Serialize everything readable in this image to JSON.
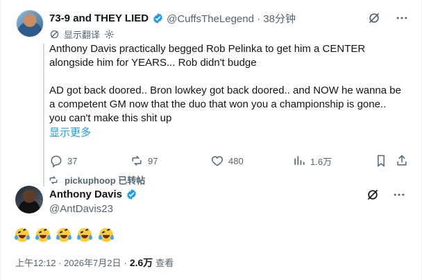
{
  "quoted_post": {
    "author_name": "73-9 and THEY LIED",
    "handle_time": "@CuffsTheLegend · 38分钟",
    "translate_text": "显示翻译",
    "body": "Anthony Davis practically begged Rob Pelinka to get him a CENTER\nalongside him for YEARS... Rob didn't budge\n\nAD got back doored.. Bron lowkey got back doored.. and NOW he wanna be\na competent GM now that the duo that won you a championship is gone..\nyou can't make this shit up",
    "show_more": "显示更多",
    "stats": {
      "replies": "37",
      "reposts": "97",
      "likes": "480",
      "views": "1.6万"
    }
  },
  "repost_banner": {
    "text": "pickuphoop 已转帖"
  },
  "main_post": {
    "author_name": "Anthony Davis",
    "handle": "@AntDavis23",
    "emoji_count": 5,
    "timestamp": "上午12:12 · 2026年7月2日",
    "views_value": "2.6万",
    "views_label": "查看"
  },
  "colors": {
    "verified": "#1d9bf0",
    "link": "#1d9bf0",
    "secondary_text": "#536471",
    "primary_text": "#0f1419"
  },
  "icons": [
    "verified-badge-icon",
    "grok-icon",
    "more-icon",
    "translate-icon",
    "settings-icon",
    "reply-icon",
    "repost-icon",
    "like-icon",
    "analytics-icon",
    "bookmark-icon",
    "share-icon",
    "laughing-crying-emoji-icon"
  ]
}
